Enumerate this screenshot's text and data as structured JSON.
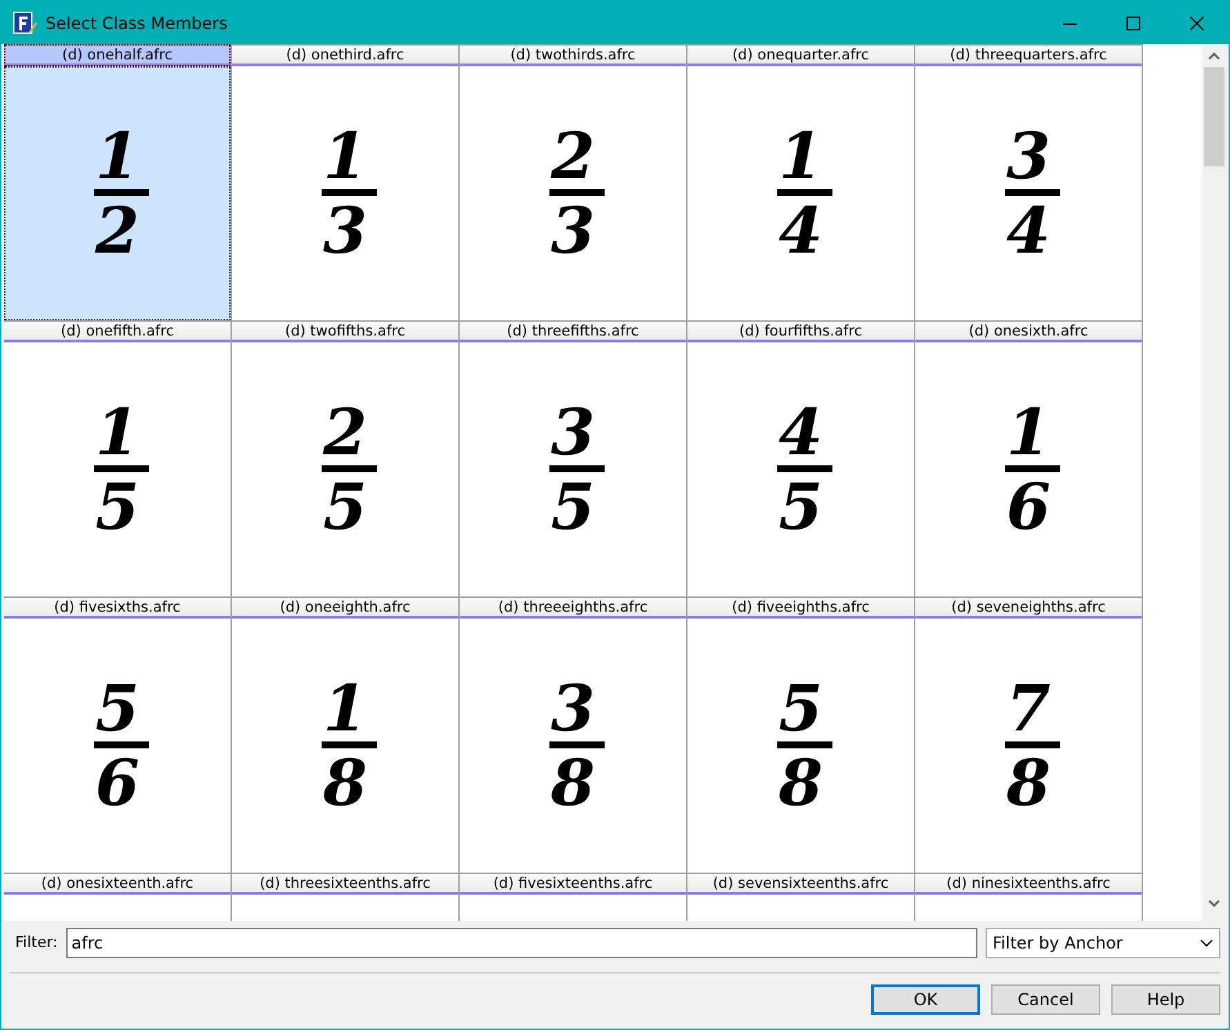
{
  "window": {
    "title": "Select Class Members"
  },
  "items": [
    {
      "label": "(d) onehalf.afrc",
      "numerator": "1",
      "denominator": "2",
      "selected": true
    },
    {
      "label": "(d) onethird.afrc",
      "numerator": "1",
      "denominator": "3",
      "selected": false
    },
    {
      "label": "(d) twothirds.afrc",
      "numerator": "2",
      "denominator": "3",
      "selected": false
    },
    {
      "label": "(d) onequarter.afrc",
      "numerator": "1",
      "denominator": "4",
      "selected": false
    },
    {
      "label": "(d) threequarters.afrc",
      "numerator": "3",
      "denominator": "4",
      "selected": false
    },
    {
      "label": "(d) onefifth.afrc",
      "numerator": "1",
      "denominator": "5",
      "selected": false
    },
    {
      "label": "(d) twofifths.afrc",
      "numerator": "2",
      "denominator": "5",
      "selected": false
    },
    {
      "label": "(d) threefifths.afrc",
      "numerator": "3",
      "denominator": "5",
      "selected": false
    },
    {
      "label": "(d) fourfifths.afrc",
      "numerator": "4",
      "denominator": "5",
      "selected": false
    },
    {
      "label": "(d) onesixth.afrc",
      "numerator": "1",
      "denominator": "6",
      "selected": false
    },
    {
      "label": "(d) fivesixths.afrc",
      "numerator": "5",
      "denominator": "6",
      "selected": false
    },
    {
      "label": "(d) oneeighth.afrc",
      "numerator": "1",
      "denominator": "8",
      "selected": false
    },
    {
      "label": "(d) threeeighths.afrc",
      "numerator": "3",
      "denominator": "8",
      "selected": false
    },
    {
      "label": "(d) fiveeighths.afrc",
      "numerator": "5",
      "denominator": "8",
      "selected": false
    },
    {
      "label": "(d) seveneighths.afrc",
      "numerator": "7",
      "denominator": "8",
      "selected": false
    },
    {
      "label": "(d) onesixteenth.afrc",
      "selected": false
    },
    {
      "label": "(d) threesixteenths.afrc",
      "selected": false
    },
    {
      "label": "(d) fivesixteenths.afrc",
      "selected": false
    },
    {
      "label": "(d) sevensixteenths.afrc",
      "selected": false
    },
    {
      "label": "(d) ninesixteenths.afrc",
      "selected": false
    }
  ],
  "filter": {
    "label": "Filter:",
    "value": "afrc",
    "mode": "Filter by Anchor"
  },
  "buttons": [
    {
      "label": "OK",
      "focused": true
    },
    {
      "label": "Cancel",
      "focused": false
    },
    {
      "label": "Help",
      "focused": false
    }
  ]
}
